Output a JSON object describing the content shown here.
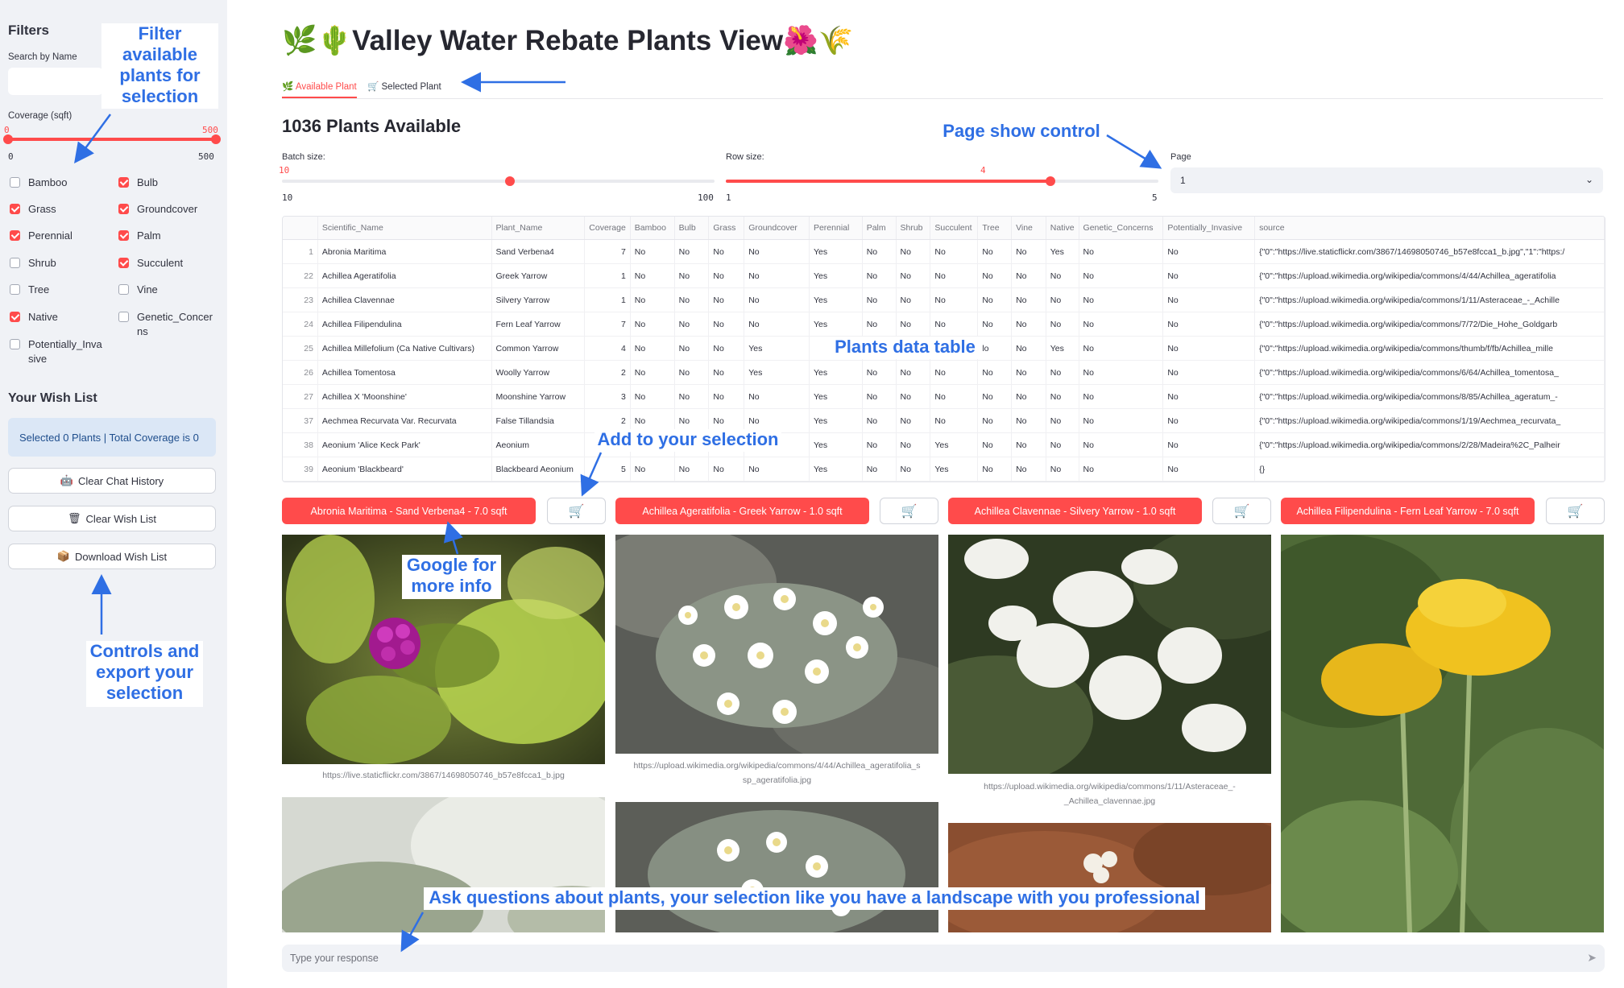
{
  "sidebar": {
    "title": "Filters",
    "search_label": "Search by Name",
    "search_value": "",
    "coverage_label": "Coverage (sqft)",
    "coverage_range": {
      "min_value": "0",
      "max_value": "500",
      "min_tick": "0",
      "max_tick": "500"
    },
    "categories": [
      {
        "label": "Bamboo",
        "checked": false
      },
      {
        "label": "Bulb",
        "checked": true
      },
      {
        "label": "Grass",
        "checked": true
      },
      {
        "label": "Groundcover",
        "checked": true
      },
      {
        "label": "Perennial",
        "checked": true
      },
      {
        "label": "Palm",
        "checked": true
      },
      {
        "label": "Shrub",
        "checked": false
      },
      {
        "label": "Succulent",
        "checked": true
      },
      {
        "label": "Tree",
        "checked": false
      },
      {
        "label": "Vine",
        "checked": false
      },
      {
        "label": "Native",
        "checked": true
      },
      {
        "label": "Genetic_Concerns",
        "checked": false
      },
      {
        "label": "Potentially_Invasive",
        "checked": false
      }
    ],
    "wish_title": "Your Wish List",
    "wish_status": "Selected 0 Plants | Total Coverage is 0",
    "buttons": [
      {
        "label": "Clear Chat History",
        "icon": "robot-icon"
      },
      {
        "label": "Clear Wish List",
        "icon": "trash-icon"
      },
      {
        "label": "Download Wish List",
        "icon": "package-icon"
      }
    ]
  },
  "header": {
    "title": "🌿🌵Valley Water Rebate Plants View🌺🌾"
  },
  "tabs": [
    {
      "label": "🌿 Available Plant",
      "active": true
    },
    {
      "label": "🛒 Selected Plant",
      "active": false
    }
  ],
  "main": {
    "heading": "1036 Plants Available",
    "batch": {
      "label": "Batch size:",
      "value": "10",
      "min": "10",
      "max": "100"
    },
    "rows": {
      "label": "Row size:",
      "value": "4",
      "min": "1",
      "max": "5",
      "fraction": 0.75
    },
    "page": {
      "label": "Page",
      "value": "1"
    }
  },
  "table": {
    "columns": [
      "Scientific_Name",
      "Plant_Name",
      "Coverage",
      "Bamboo",
      "Bulb",
      "Grass",
      "Groundcover",
      "Perennial",
      "Palm",
      "Shrub",
      "Succulent",
      "Tree",
      "Vine",
      "Native",
      "Genetic_Concerns",
      "Potentially_Invasive",
      "source"
    ],
    "rows": [
      [
        "1",
        "Abronia Maritima",
        "Sand Verbena4",
        "7",
        "No",
        "No",
        "No",
        "No",
        "Yes",
        "No",
        "No",
        "No",
        "No",
        "No",
        "Yes",
        "No",
        "No",
        "{\"0\":\"https://live.staticflickr.com/3867/14698050746_b57e8fcca1_b.jpg\",\"1\":\"https:/"
      ],
      [
        "22",
        "Achillea Ageratifolia",
        "Greek Yarrow",
        "1",
        "No",
        "No",
        "No",
        "No",
        "Yes",
        "No",
        "No",
        "No",
        "No",
        "No",
        "No",
        "No",
        "No",
        "{\"0\":\"https://upload.wikimedia.org/wikipedia/commons/4/44/Achillea_ageratifolia"
      ],
      [
        "23",
        "Achillea Clavennae",
        "Silvery Yarrow",
        "1",
        "No",
        "No",
        "No",
        "No",
        "Yes",
        "No",
        "No",
        "No",
        "No",
        "No",
        "No",
        "No",
        "No",
        "{\"0\":\"https://upload.wikimedia.org/wikipedia/commons/1/11/Asteraceae_-_Achille"
      ],
      [
        "24",
        "Achillea Filipendulina",
        "Fern Leaf Yarrow",
        "7",
        "No",
        "No",
        "No",
        "No",
        "Yes",
        "No",
        "No",
        "No",
        "No",
        "No",
        "No",
        "No",
        "No",
        "{\"0\":\"https://upload.wikimedia.org/wikipedia/commons/7/72/Die_Hohe_Goldgarb"
      ],
      [
        "25",
        "Achillea Millefolium (Ca Native Cultivars)",
        "Common Yarrow",
        "4",
        "No",
        "No",
        "No",
        "Yes",
        "",
        "",
        "",
        "",
        "lo",
        "No",
        "Yes",
        "No",
        "No",
        "{\"0\":\"https://upload.wikimedia.org/wikipedia/commons/thumb/f/fb/Achillea_mille"
      ],
      [
        "26",
        "Achillea Tomentosa",
        "Woolly Yarrow",
        "2",
        "No",
        "No",
        "No",
        "Yes",
        "Yes",
        "No",
        "No",
        "No",
        "No",
        "No",
        "No",
        "No",
        "No",
        "{\"0\":\"https://upload.wikimedia.org/wikipedia/commons/6/64/Achillea_tomentosa_"
      ],
      [
        "27",
        "Achillea X 'Moonshine'",
        "Moonshine Yarrow",
        "3",
        "No",
        "No",
        "No",
        "No",
        "Yes",
        "No",
        "No",
        "No",
        "No",
        "No",
        "No",
        "No",
        "No",
        "{\"0\":\"https://upload.wikimedia.org/wikipedia/commons/8/85/Achillea_ageratum_-"
      ],
      [
        "37",
        "Aechmea Recurvata Var. Recurvata",
        "False Tillandsia",
        "2",
        "No",
        "No",
        "No",
        "No",
        "Yes",
        "No",
        "No",
        "No",
        "No",
        "No",
        "No",
        "No",
        "No",
        "{\"0\":\"https://upload.wikimedia.org/wikipedia/commons/1/19/Aechmea_recurvata_"
      ],
      [
        "38",
        "Aeonium 'Alice Keck Park'",
        "Aeonium",
        "",
        "",
        "",
        "",
        "",
        "Yes",
        "No",
        "No",
        "Yes",
        "No",
        "No",
        "No",
        "No",
        "No",
        "{\"0\":\"https://upload.wikimedia.org/wikipedia/commons/2/28/Madeira%2C_Palheir"
      ],
      [
        "39",
        "Aeonium 'Blackbeard'",
        "Blackbeard Aeonium",
        "5",
        "No",
        "No",
        "No",
        "No",
        "Yes",
        "No",
        "No",
        "Yes",
        "No",
        "No",
        "No",
        "No",
        "No",
        "{}"
      ]
    ]
  },
  "cards": [
    {
      "button": "Abronia Maritima - Sand Verbena4 - 7.0 sqft",
      "caption": "https://live.staticflickr.com/3867/14698050746_b57e8fcca1_b.jpg"
    },
    {
      "button": "Achillea Ageratifolia - Greek Yarrow - 1.0 sqft",
      "caption": "https://upload.wikimedia.org/wikipedia/commons/4/44/Achillea_ageratifolia_s sp_ageratifolia.jpg"
    },
    {
      "button": "Achillea Clavennae - Silvery Yarrow - 1.0 sqft",
      "caption": "https://upload.wikimedia.org/wikipedia/commons/1/11/Asteraceae_- _Achillea_clavennae.jpg"
    },
    {
      "button": "Achillea Filipendulina - Fern Leaf Yarrow - 7.0 sqft",
      "caption": ""
    }
  ],
  "chat": {
    "placeholder": "Type your response"
  },
  "annotations": {
    "filter": "Filter available plants for selection",
    "tabs_arrow": "",
    "page_control": "Page show control",
    "data_table": "Plants data table",
    "add_selection": "Add to your selection",
    "google": "Google for more info",
    "controls": "Controls and export your selection",
    "ask": "Ask questions about plants, your selection like you have a landscape with you professional"
  },
  "colors": {
    "accent": "#ff4b4b",
    "sidebar_bg": "#f0f2f6",
    "annotation": "#2f6fe4",
    "wish_bg": "#dbe7f6"
  }
}
